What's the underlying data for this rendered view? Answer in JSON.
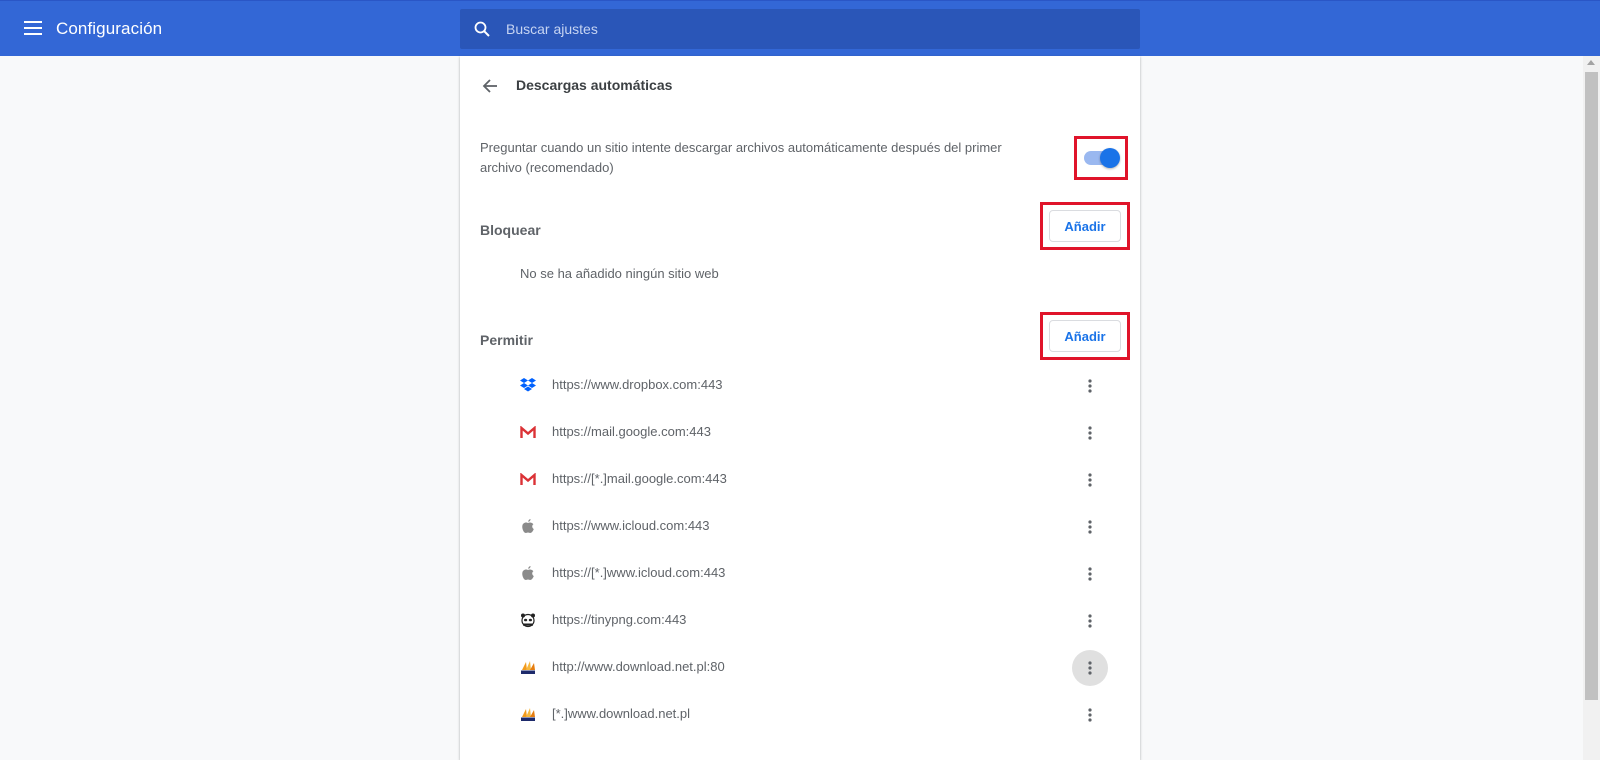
{
  "header": {
    "title": "Configuración",
    "search_placeholder": "Buscar ajustes"
  },
  "page": {
    "title": "Descargas automáticas",
    "setting_text": "Preguntar cuando un sitio intente descargar archivos automáticamente después del primer archivo (recomendado)",
    "toggle_on": true
  },
  "block": {
    "heading": "Bloquear",
    "add_label": "Añadir",
    "empty_text": "No se ha añadido ningún sitio web"
  },
  "allow": {
    "heading": "Permitir",
    "add_label": "Añadir",
    "sites": [
      {
        "url": "https://www.dropbox.com:443",
        "icon": "dropbox-icon"
      },
      {
        "url": "https://mail.google.com:443",
        "icon": "gmail-icon"
      },
      {
        "url": "https://[*.]mail.google.com:443",
        "icon": "gmail-icon"
      },
      {
        "url": "https://www.icloud.com:443",
        "icon": "apple-icon"
      },
      {
        "url": "https://[*.]www.icloud.com:443",
        "icon": "apple-icon"
      },
      {
        "url": "https://tinypng.com:443",
        "icon": "panda-icon"
      },
      {
        "url": "http://www.download.net.pl:80",
        "icon": "pma-icon"
      },
      {
        "url": "[*.]www.download.net.pl",
        "icon": "pma-icon"
      }
    ]
  },
  "colors": {
    "header_bg": "#3367d6",
    "accent": "#1a73e8",
    "highlight_frame": "#e0142a"
  }
}
